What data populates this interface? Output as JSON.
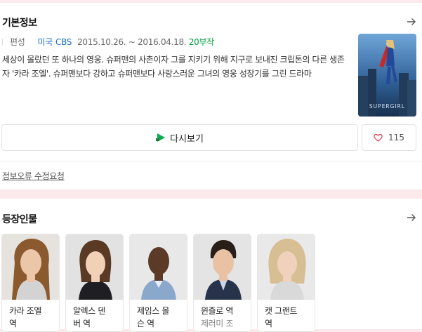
{
  "basic_info": {
    "title": "기본정보",
    "genre": "편성",
    "country": "미국",
    "channel": "CBS",
    "dates": "2015.10.26. ~ 2016.04.18.",
    "episodes": "20부작",
    "description": "세상이 몰랐던 또 하나의 영웅. 슈퍼맨의 사촌이자 그를 지키기 위해 지구로 보내진 크립톤의 다른 생존자 '카라 조엘'. 슈퍼맨보다 강하고 슈퍼맨보다 사랑스러운 그녀의 영웅 성장기를 그린 드라마",
    "poster_text": "SUPERGIRL",
    "replay_label": "다시보기",
    "like_count": "115",
    "report_label": "정보오류 수정요청"
  },
  "characters": {
    "title": "등장인물",
    "items": [
      {
        "role": "카라 조엘",
        "role2": "역",
        "actor": ""
      },
      {
        "role": "알렉스 덴",
        "role2": "버 역",
        "actor": ""
      },
      {
        "role": "제임스 올",
        "role2": "슨 역",
        "actor": ""
      },
      {
        "role": "윈즐로 역",
        "role2": "",
        "actor": "제러미 조"
      },
      {
        "role": "캣 그랜트",
        "role2": "역",
        "actor": ""
      }
    ]
  },
  "colors": {
    "accent_blue": "#1a6fc9",
    "episodes_green": "#00a040",
    "like_heart": "#e0405a"
  }
}
